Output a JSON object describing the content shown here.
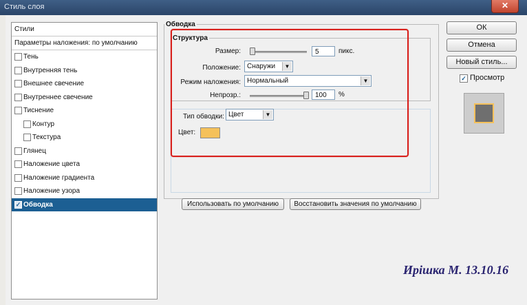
{
  "window": {
    "title": "Стиль слоя",
    "close_glyph": "✕"
  },
  "styles_list": {
    "header": "Стили",
    "blend_defaults": "Параметры наложения: по умолчанию",
    "items": [
      {
        "label": "Тень",
        "checked": false,
        "indent": 0
      },
      {
        "label": "Внутренняя тень",
        "checked": false,
        "indent": 0
      },
      {
        "label": "Внешнее свечение",
        "checked": false,
        "indent": 0
      },
      {
        "label": "Внутреннее свечение",
        "checked": false,
        "indent": 0
      },
      {
        "label": "Тиснение",
        "checked": false,
        "indent": 0
      },
      {
        "label": "Контур",
        "checked": false,
        "indent": 1
      },
      {
        "label": "Текстура",
        "checked": false,
        "indent": 1
      },
      {
        "label": "Глянец",
        "checked": false,
        "indent": 0
      },
      {
        "label": "Наложение цвета",
        "checked": false,
        "indent": 0
      },
      {
        "label": "Наложение градиента",
        "checked": false,
        "indent": 0
      },
      {
        "label": "Наложение узора",
        "checked": false,
        "indent": 0
      },
      {
        "label": "Обводка",
        "checked": true,
        "indent": 0,
        "active": true
      }
    ],
    "check_glyph": "✓"
  },
  "stroke": {
    "title": "Обводка",
    "structure": {
      "title": "Структура",
      "size_label": "Размер:",
      "size_value": "5",
      "size_unit": "пикс.",
      "size_fraction": 0.02,
      "position_label": "Положение:",
      "position_value": "Снаружи",
      "blend_label": "Режим наложения:",
      "blend_value": "Нормальный",
      "opacity_label": "Непрозр.:",
      "opacity_value": "100",
      "opacity_unit": "%",
      "opacity_fraction": 1.0
    },
    "fill_type_label": "Тип обводки:",
    "fill_type_value": "Цвет",
    "color_label": "Цвет:",
    "color_hex": "#f5c15a",
    "default_button": "Использовать по умолчанию",
    "reset_button": "Восстановить значения по умолчанию"
  },
  "buttons": {
    "ok": "ОК",
    "cancel": "Отмена",
    "new_style": "Новый стиль...",
    "preview_label": "Просмотр",
    "preview_checked": true
  },
  "annotation": {
    "highlight_color": "#d8201c"
  },
  "signature": "Ирішка М. 13.10.16"
}
